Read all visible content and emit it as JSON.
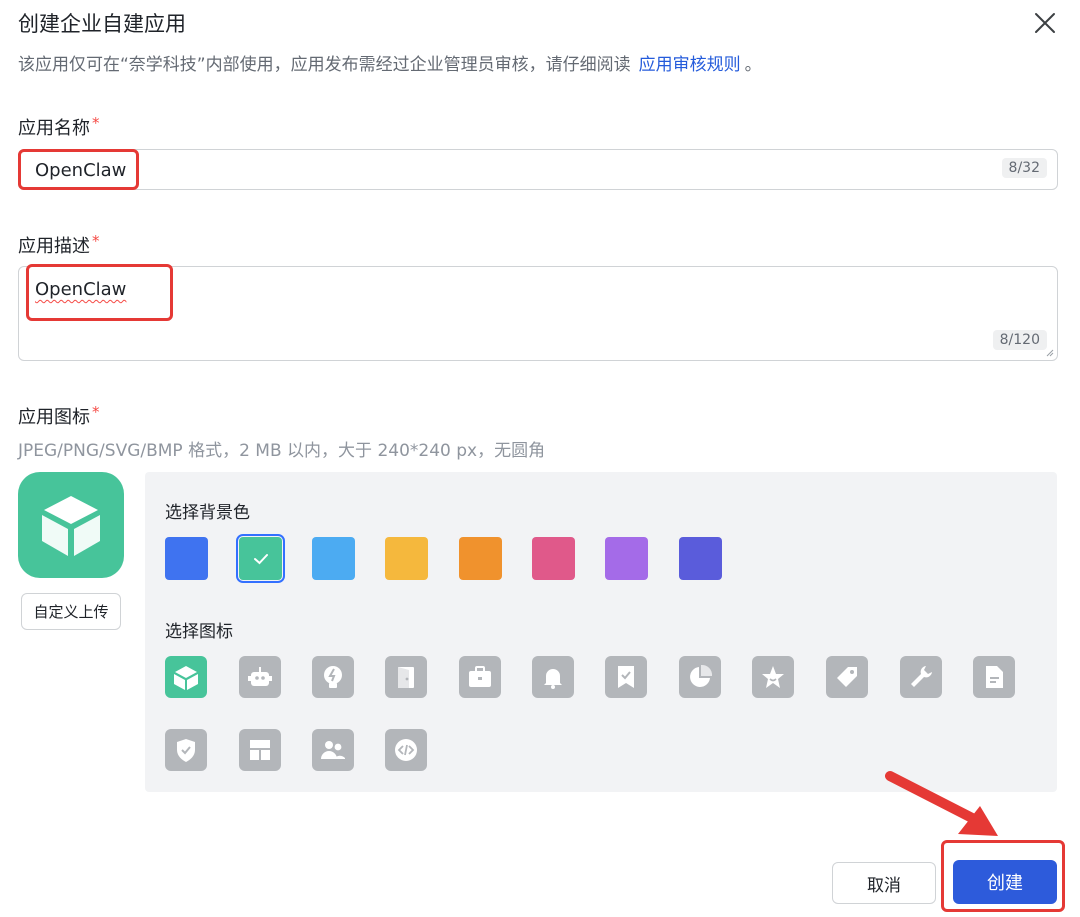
{
  "dialog": {
    "title": "创建企业自建应用",
    "close_icon": "close-icon",
    "subtitle": "该应用仅可在“奈学科技”内部使用，应用发布需经过企业管理员审核，请仔细阅读",
    "subtitle_link": "应用审核规则",
    "subtitle_end": "。"
  },
  "form": {
    "required_mark": "*",
    "name": {
      "label": "应用名称",
      "value": "OpenClaw",
      "counter": "8/32"
    },
    "description": {
      "label": "应用描述",
      "value": "OpenClaw",
      "counter": "8/120"
    },
    "icon": {
      "label": "应用图标",
      "hint": "JPEG/PNG/SVG/BMP 格式，2 MB 以内，大于 240*240 px，无圆角",
      "upload_label": "自定义上传",
      "bg_section_label": "选择背景色",
      "icon_section_label": "选择图标",
      "bg_colors": [
        "#3f73f0",
        "#47c49a",
        "#4cabf2",
        "#f5b83d",
        "#f0922d",
        "#e0598a",
        "#a46be8",
        "#5a5cdb"
      ],
      "selected_bg_index": 1,
      "icon_names": [
        "cube-icon",
        "robot-icon",
        "lightbulb-icon",
        "door-icon",
        "briefcase-icon",
        "bell-icon",
        "bookmark-check-icon",
        "pie-chart-icon",
        "star-icon",
        "tag-icon",
        "wrench-icon",
        "document-icon",
        "shield-check-icon",
        "layout-icon",
        "users-icon",
        "code-icon"
      ],
      "selected_icon_index": 0
    }
  },
  "footer": {
    "cancel_label": "取消",
    "create_label": "创建"
  },
  "colors": {
    "primary": "#2d5bdb",
    "link": "#245bdb",
    "icon_green": "#47c49a",
    "annotation_red": "#e53935"
  }
}
